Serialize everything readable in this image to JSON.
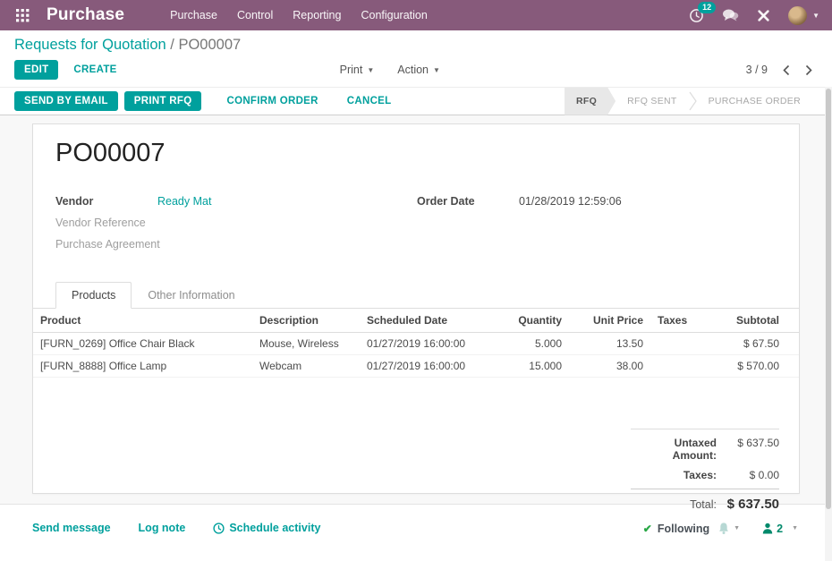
{
  "colors": {
    "brand": "#875a7b",
    "accent": "#00a09d"
  },
  "nav": {
    "app_name": "Purchase",
    "menus": [
      "Purchase",
      "Control",
      "Reporting",
      "Configuration"
    ],
    "activity_badge": "12",
    "icons": {
      "apps": "grid-icon",
      "activities": "clock-icon",
      "messages": "chat-bubbles-icon",
      "tools": "crossed-tools-icon",
      "user_menu": "avatar-with-caret"
    }
  },
  "breadcrumb": {
    "parent": "Requests for Quotation",
    "separator": "/",
    "current": "PO00007"
  },
  "control_panel": {
    "edit_label": "EDIT",
    "create_label": "CREATE",
    "print_label": "Print",
    "action_label": "Action",
    "pager": "3 / 9"
  },
  "statusbar": {
    "send_by_email": "SEND BY EMAIL",
    "print_rfq": "PRINT RFQ",
    "confirm_order": "CONFIRM ORDER",
    "cancel": "CANCEL",
    "states": [
      {
        "label": "RFQ"
      },
      {
        "label": "RFQ SENT"
      },
      {
        "label": "PURCHASE ORDER"
      }
    ],
    "active_state": "RFQ"
  },
  "sheet": {
    "title": "PO00007",
    "fields": {
      "vendor_label": "Vendor",
      "vendor_value": "Ready Mat",
      "vendor_reference_label": "Vendor Reference",
      "purchase_agreement_label": "Purchase Agreement",
      "order_date_label": "Order Date",
      "order_date_value": "01/28/2019 12:59:06"
    },
    "tabs": [
      {
        "label": "Products"
      },
      {
        "label": "Other Information"
      }
    ],
    "table": {
      "headers": [
        "Product",
        "Description",
        "Scheduled Date",
        "Quantity",
        "Unit Price",
        "Taxes",
        "Subtotal"
      ],
      "rows": [
        {
          "product": "[FURN_0269] Office Chair Black",
          "description": "Mouse, Wireless",
          "scheduled_date": "01/27/2019 16:00:00",
          "quantity": "5.000",
          "unit_price": "13.50",
          "taxes": "",
          "subtotal": "$ 67.50"
        },
        {
          "product": "[FURN_8888] Office Lamp",
          "description": "Webcam",
          "scheduled_date": "01/27/2019 16:00:00",
          "quantity": "15.000",
          "unit_price": "38.00",
          "taxes": "",
          "subtotal": "$ 570.00"
        }
      ]
    },
    "totals": {
      "untaxed_label": "Untaxed Amount:",
      "untaxed_value": "$ 637.50",
      "taxes_label": "Taxes:",
      "taxes_value": "$ 0.00",
      "total_label": "Total:",
      "total_value": "$ 637.50"
    }
  },
  "chatter": {
    "send_message": "Send message",
    "log_note": "Log note",
    "schedule_activity": "Schedule activity",
    "following": "Following",
    "followers_count": "2"
  }
}
